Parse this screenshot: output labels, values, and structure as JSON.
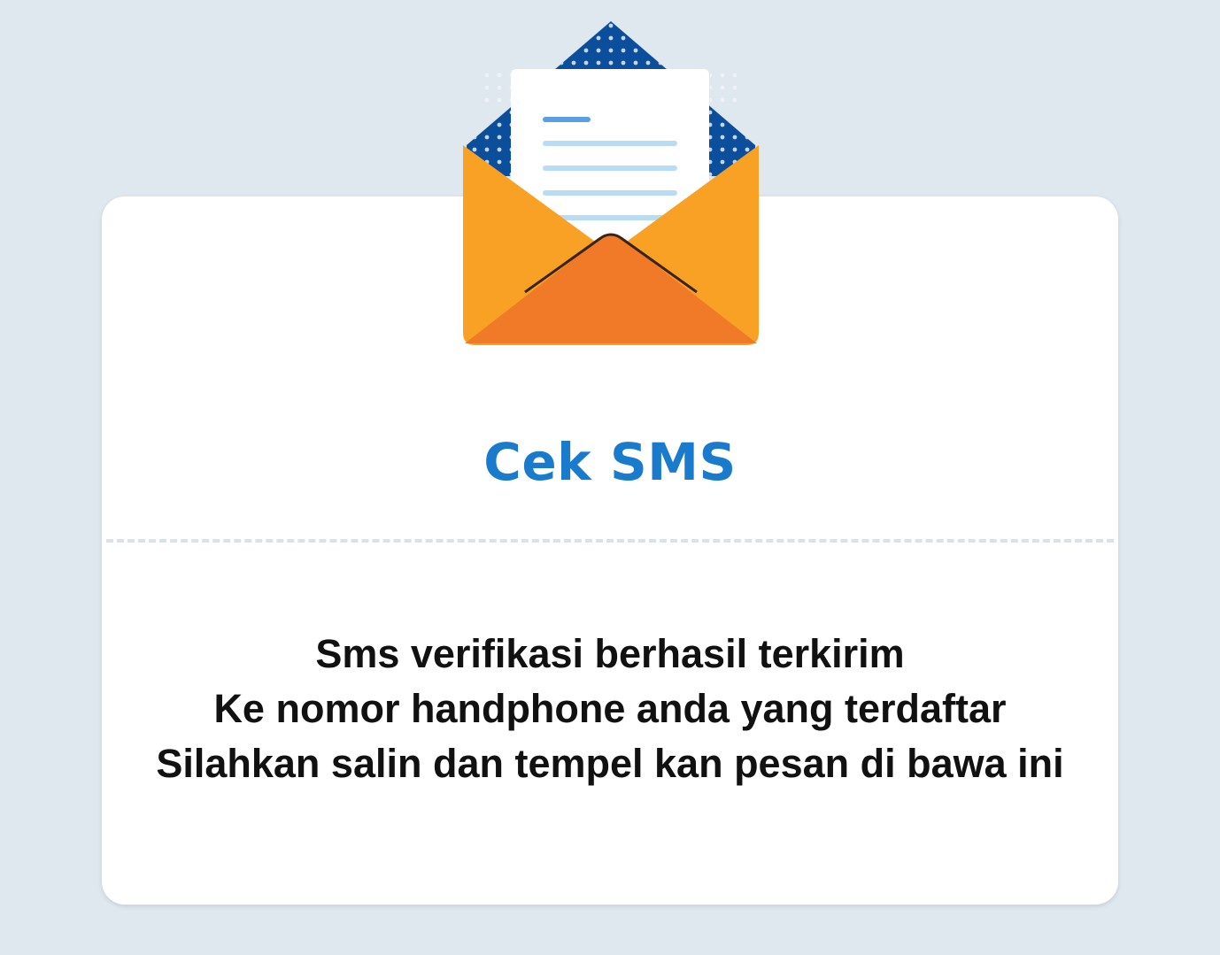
{
  "card": {
    "title": "Cek SMS",
    "message_lines": [
      "Sms verifikasi berhasil terkirim",
      "Ke nomor handphone anda yang terdaftar",
      "Silahkan salin dan tempel kan pesan di bawa ini"
    ]
  },
  "illustration": {
    "icon": "open-envelope-icon"
  },
  "colors": {
    "background": "#dfe7ef",
    "card": "#ffffff",
    "title": "#1a7bcc",
    "text": "#111111",
    "envelope_orange": "#f9a125",
    "envelope_front": "#f07a27",
    "envelope_flap_blue": "#0b4f9c",
    "letter_line": "#b9dcf5"
  }
}
